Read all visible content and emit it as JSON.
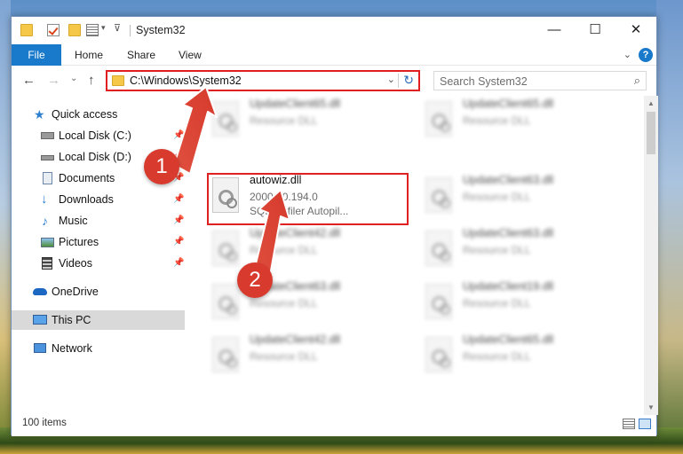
{
  "window": {
    "title": "System32",
    "controls": {
      "minimize": "—",
      "maximize": "☐",
      "close": "✕"
    }
  },
  "ribbon": {
    "file_tab": "File",
    "tabs": [
      "Home",
      "Share",
      "View"
    ]
  },
  "address": {
    "path": "C:\\Windows\\System32",
    "search_placeholder": "Search System32"
  },
  "sidebar": {
    "items": [
      {
        "label": "Quick access",
        "icon": "star-icon",
        "pinned": false
      },
      {
        "label": "Local Disk (C:)",
        "icon": "drive-icon",
        "pinned": true
      },
      {
        "label": "Local Disk (D:)",
        "icon": "drive-icon",
        "pinned": true
      },
      {
        "label": "Documents",
        "icon": "documents-icon",
        "pinned": true
      },
      {
        "label": "Downloads",
        "icon": "download-icon",
        "pinned": true
      },
      {
        "label": "Music",
        "icon": "music-icon",
        "pinned": true
      },
      {
        "label": "Pictures",
        "icon": "pictures-icon",
        "pinned": true
      },
      {
        "label": "Videos",
        "icon": "videos-icon",
        "pinned": true
      },
      {
        "label": "OneDrive",
        "icon": "cloud-icon",
        "pinned": false
      },
      {
        "label": "This PC",
        "icon": "computer-icon",
        "pinned": false,
        "selected": true
      },
      {
        "label": "Network",
        "icon": "network-icon",
        "pinned": false
      }
    ]
  },
  "files": {
    "highlighted": {
      "name": "autowiz.dll",
      "version": "2000.80.194.0",
      "description": "SQLProfiler Autopil..."
    },
    "left_column": [
      {
        "name": "UpdateClient65.dll",
        "type": "Resource DLL"
      },
      {
        "name": "UpdateClient42.dll",
        "type": "Resource DLL"
      },
      {
        "name": "UpdateClient63.dll",
        "type": "Resource DLL"
      },
      {
        "name": "UpdateClient42.dll",
        "type": "Resource DLL"
      }
    ],
    "right_column": [
      {
        "name": "UpdateClient65.dll",
        "type": "Resource DLL"
      },
      {
        "name": "UpdateClient63.dll",
        "type": "Resource DLL"
      },
      {
        "name": "UpdateClient63.dll",
        "type": "Resource DLL"
      },
      {
        "name": "UpdateClient19.dll",
        "type": "Resource DLL"
      },
      {
        "name": "UpdateClient65.dll",
        "type": "Resource DLL"
      }
    ]
  },
  "status": {
    "item_count": "100 items"
  },
  "annotations": {
    "step1": "1",
    "step2": "2"
  },
  "colors": {
    "accent": "#1979ca",
    "highlight": "#e02020",
    "badge": "#d83a2e"
  }
}
